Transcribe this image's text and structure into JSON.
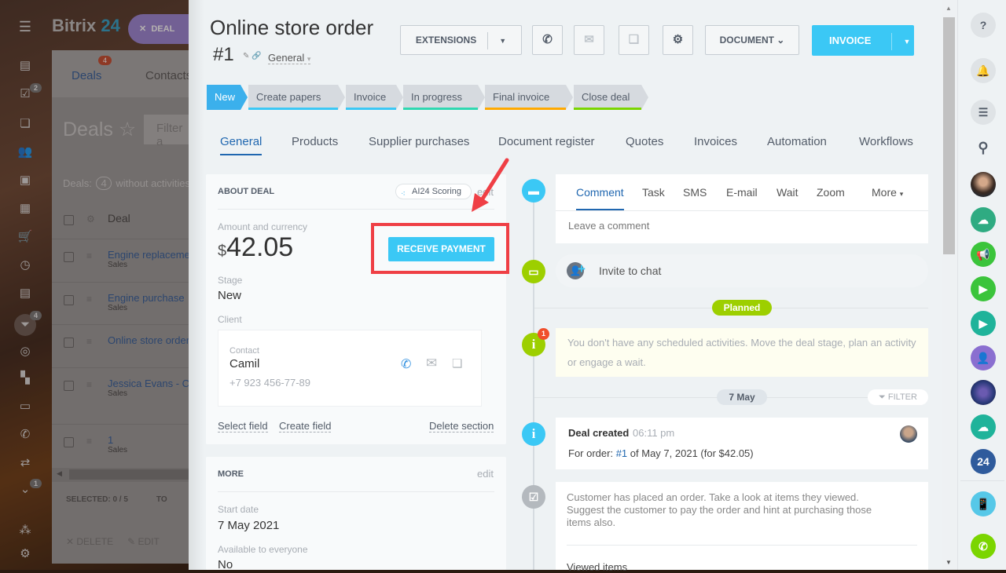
{
  "background_app": {
    "brand_name": "Bitrix",
    "brand_num": "24",
    "deal_pill_label": "DEAL",
    "tabs": [
      {
        "label": "Deals",
        "badge": "4"
      },
      {
        "label": "Contacts"
      }
    ],
    "page_title": "Deals",
    "filter_placeholder": "Filter a",
    "deals_info_prefix": "Deals:",
    "deals_info_count": "4",
    "deals_info_suffix": "without activities",
    "column_header": "Deal",
    "rows": [
      {
        "name": "Engine replacement",
        "pipeline": "Sales"
      },
      {
        "name": "Engine purchase",
        "pipeline": "Sales"
      },
      {
        "name": "Online store order",
        "pipeline": ""
      },
      {
        "name": "Jessica Evans - C",
        "pipeline": "Sales"
      },
      {
        "name": "1",
        "pipeline": "Sales"
      }
    ],
    "selected_label": "SELECTED: 0 / 5",
    "total_label": "TO",
    "delete_label": "DELETE",
    "edit_label": "EDIT",
    "left_sidebar_badges": {
      "tasks": "2",
      "crm": "4",
      "more": "1"
    }
  },
  "deal": {
    "title_line1": "Online store order",
    "title_line2": "#1",
    "category": "General",
    "toolbar": {
      "extensions": "EXTENSIONS",
      "document": "DOCUMENT",
      "invoice": "INVOICE"
    },
    "stages": [
      {
        "label": "New",
        "color": "#3bb0ec",
        "current": true
      },
      {
        "label": "Create papers",
        "color": "#3bc8f5"
      },
      {
        "label": "Invoice",
        "color": "#3bc8f5"
      },
      {
        "label": "In progress",
        "color": "#2fd8b1"
      },
      {
        "label": "Final invoice",
        "color": "#ffa900"
      },
      {
        "label": "Close deal",
        "color": "#7bd500"
      }
    ],
    "tabs": [
      "General",
      "Products",
      "Supplier purchases",
      "Document register",
      "Quotes",
      "Invoices",
      "Automation",
      "Workflows"
    ],
    "about": {
      "header": "ABOUT DEAL",
      "ai_scoring": "AI24 Scoring",
      "edit": "edit",
      "amount_label": "Amount and currency",
      "currency": "$",
      "amount": "42.05",
      "receive_payment": "RECEIVE PAYMENT",
      "stage_label": "Stage",
      "stage_value": "New",
      "client_label": "Client",
      "contact_label": "Contact",
      "contact_name": "Camil",
      "contact_phone": "+7 923 456-77-89",
      "select_field": "Select field",
      "create_field": "Create field",
      "delete_section": "Delete section"
    },
    "more": {
      "header": "MORE",
      "edit": "edit",
      "start_date_label": "Start date",
      "start_date": "7 May 2021",
      "available_label": "Available to everyone",
      "available": "No"
    }
  },
  "timeline": {
    "tabs": [
      "Comment",
      "Task",
      "SMS",
      "E-mail",
      "Wait",
      "Zoom",
      "More"
    ],
    "comment_placeholder": "Leave a comment",
    "invite_to_chat": "Invite to chat",
    "planned": "Planned",
    "alert_badge": "1",
    "no_activities": "You don't have any scheduled activities. Move the deal stage, plan an activity or engage a wait.",
    "date_pill": "7 May",
    "filter": "FILTER",
    "deal_created": "Deal created",
    "deal_created_time": "06:11 pm",
    "order_prefix": "For order:",
    "order_link": "#1",
    "order_suffix": "of May 7, 2021 (for $42.05)",
    "suggestion": "Customer has placed an order. Take a look at items they viewed. Suggest the customer to pay the order and hint at purchasing those items also.",
    "viewed_items": "Viewed items"
  },
  "right_sidebar": {
    "counter_24": "24"
  },
  "colors": {
    "accent": "#3bc8f5",
    "link": "#2067b0",
    "highlight_red": "#ef3f45",
    "green": "#9dcf00"
  }
}
